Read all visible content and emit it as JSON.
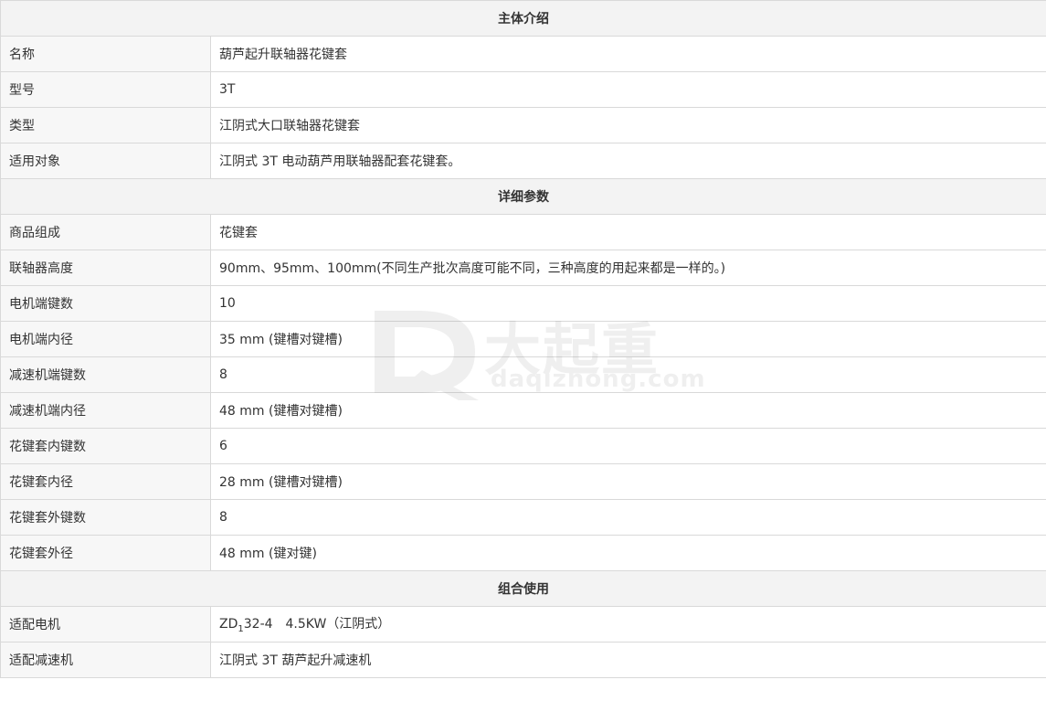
{
  "sections": [
    {
      "title": "主体介绍",
      "rows": [
        {
          "label": "名称",
          "value": "葫芦起升联轴器花键套"
        },
        {
          "label": "型号",
          "value": "3T"
        },
        {
          "label": "类型",
          "value": "江阴式大口联轴器花键套"
        },
        {
          "label": "适用对象",
          "value": "江阴式 3T 电动葫芦用联轴器配套花键套。"
        }
      ]
    },
    {
      "title": "详细参数",
      "rows": [
        {
          "label": "商品组成",
          "value": "花键套"
        },
        {
          "label": "联轴器高度",
          "value": "90mm、95mm、100mm(不同生产批次高度可能不同，三种高度的用起来都是一样的。)"
        },
        {
          "label": "电机端键数",
          "value": "10"
        },
        {
          "label": "电机端内径",
          "value": "35 mm (键槽对键槽)"
        },
        {
          "label": "减速机端键数",
          "value": "8"
        },
        {
          "label": "减速机端内径",
          "value": "48 mm (键槽对键槽)"
        },
        {
          "label": "花键套内键数",
          "value": "6"
        },
        {
          "label": "花键套内径",
          "value": "28 mm (键槽对键槽)"
        },
        {
          "label": "花键套外键数",
          "value": "8"
        },
        {
          "label": "花键套外径",
          "value": "48 mm (键对键)"
        }
      ]
    },
    {
      "title": "组合使用",
      "rows": [
        {
          "label": "适配电机",
          "value_prefix": "ZD",
          "value_sub": "1",
          "value_rest": "32-4　4.5KW（江阴式）"
        },
        {
          "label": "适配减速机",
          "value": "江阴式 3T 葫芦起升减速机"
        }
      ]
    }
  ],
  "watermark": {
    "cn": "大起重",
    "en": "daqizhong.com"
  }
}
